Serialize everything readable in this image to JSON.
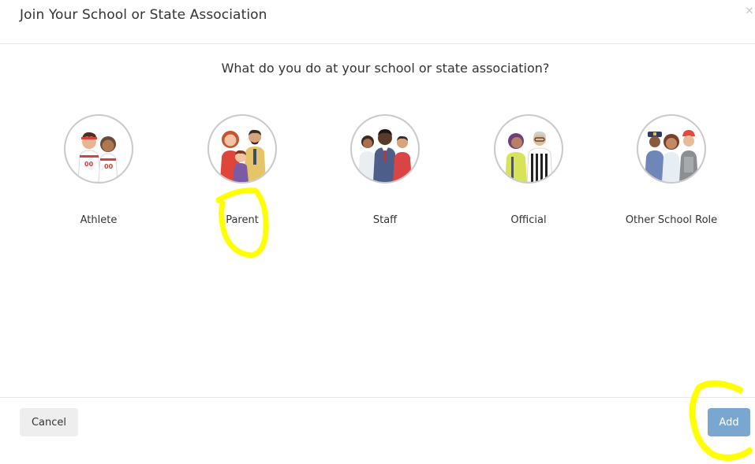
{
  "modal": {
    "title": "Join Your School or State Association",
    "close_icon": "close-icon",
    "question": "What do you do at your school or state association?"
  },
  "roles": [
    {
      "label": "Athlete",
      "icon": "athlete-icon"
    },
    {
      "label": "Parent",
      "icon": "parent-icon"
    },
    {
      "label": "Staff",
      "icon": "staff-icon"
    },
    {
      "label": "Official",
      "icon": "official-icon"
    },
    {
      "label": "Other School Role",
      "icon": "other-role-icon"
    }
  ],
  "footer": {
    "cancel_label": "Cancel",
    "add_label": "Add"
  },
  "colors": {
    "add_button": "#7aa7cf",
    "highlight": "#ffff00"
  }
}
